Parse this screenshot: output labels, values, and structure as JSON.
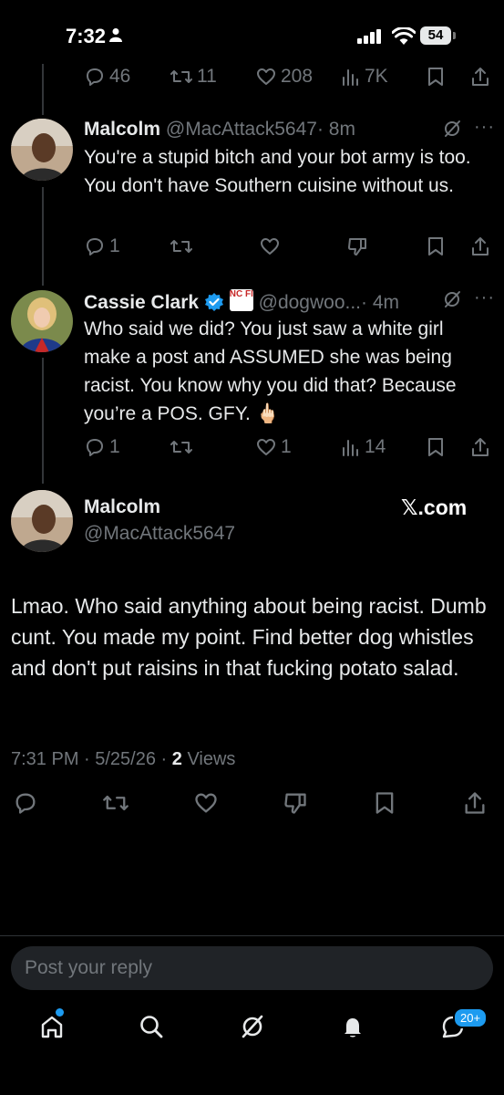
{
  "status_bar": {
    "time": "7:32",
    "battery": "54"
  },
  "top_tweet_actions": {
    "replies": "46",
    "retweets": "11",
    "likes": "208",
    "views": "7K"
  },
  "reply1": {
    "name": "Malcolm",
    "handle": "@MacAttack5647",
    "time": "· 8m",
    "text": "You're a stupid bitch and your bot army is too. You don't have Southern cuisine without us.",
    "replies": "1"
  },
  "reply2": {
    "name": "Cassie Clark",
    "badge_text": "NC FIRST",
    "handle": "@dogwoo...",
    "time": "· 4m",
    "text": "Who said we did? You just saw a white girl make a post and ASSUMED she was being racist. You know why you did that? Because you’re a POS. GFY. 🖕🏻",
    "replies": "1",
    "likes": "1",
    "views": "14"
  },
  "main_tweet": {
    "name": "Malcolm",
    "handle": "@MacAttack5647",
    "source": "𝕏.com",
    "text": "Lmao. Who said anything about being racist. Dumb cunt. You made my point. Find better dog whistles and don't put raisins in that fucking potato salad.",
    "timestamp": "7:31 PM · 5/25/26 · ",
    "views_count": "2",
    "views_label": " Views"
  },
  "reply_box": {
    "placeholder": "Post your reply"
  },
  "tabbar": {
    "notifications_badge": "20+"
  },
  "colors": {
    "accent": "#1d9bf0",
    "muted": "#71767b",
    "text": "#e7e9ea",
    "verified": "#1d9bf0"
  }
}
